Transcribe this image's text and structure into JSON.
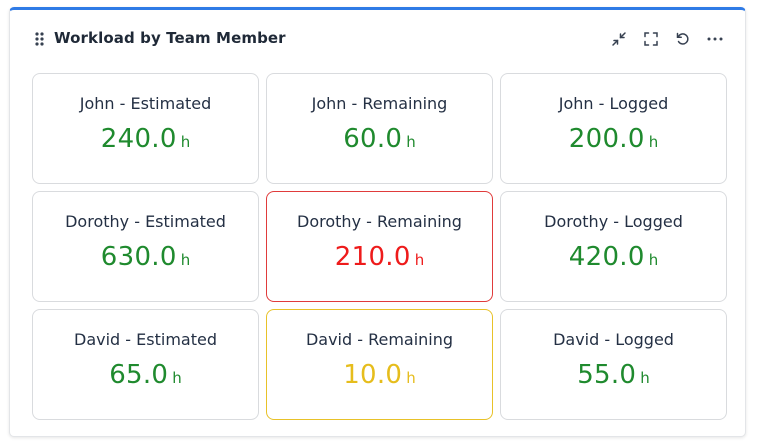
{
  "widget": {
    "title": "Workload by Team Member",
    "actions": [
      {
        "icon": "collapse-icon"
      },
      {
        "icon": "fullscreen-icon"
      },
      {
        "icon": "refresh-icon"
      },
      {
        "icon": "more-icon"
      }
    ]
  },
  "colors": {
    "accent": "#2f7be6",
    "ok": "#1f8a2e",
    "danger": "#ee1b1b",
    "warning": "#e6bd1c"
  },
  "cards": [
    {
      "label": "John - Estimated",
      "value": "240.0",
      "unit": "h",
      "status": "ok"
    },
    {
      "label": "John - Remaining",
      "value": "60.0",
      "unit": "h",
      "status": "ok"
    },
    {
      "label": "John - Logged",
      "value": "200.0",
      "unit": "h",
      "status": "ok"
    },
    {
      "label": "Dorothy - Estimated",
      "value": "630.0",
      "unit": "h",
      "status": "ok"
    },
    {
      "label": "Dorothy - Remaining",
      "value": "210.0",
      "unit": "h",
      "status": "danger"
    },
    {
      "label": "Dorothy - Logged",
      "value": "420.0",
      "unit": "h",
      "status": "ok"
    },
    {
      "label": "David - Estimated",
      "value": "65.0",
      "unit": "h",
      "status": "ok"
    },
    {
      "label": "David - Remaining",
      "value": "10.0",
      "unit": "h",
      "status": "warning"
    },
    {
      "label": "David - Logged",
      "value": "55.0",
      "unit": "h",
      "status": "ok"
    }
  ]
}
